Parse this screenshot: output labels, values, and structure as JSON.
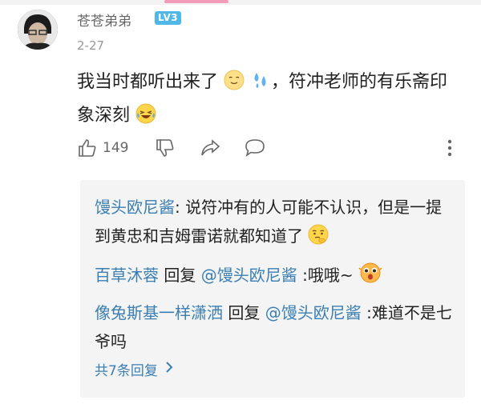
{
  "comment": {
    "username": "苍苍弟弟",
    "level": "LV3",
    "date": "2-27",
    "content_part1": "我当时都听出来了",
    "content_part2": "，符冲老师的有乐斋印象深刻",
    "like_count": "149"
  },
  "replies": [
    {
      "author": "馒头欧尼酱",
      "separator": ": ",
      "text": "说符冲有的人可能不认识，但是一提到黄忠和吉姆雷诺就都知道了"
    },
    {
      "author": "百草沐蓉",
      "reply_word": " 回复 ",
      "target": "@馒头欧尼酱",
      "text": " :哦哦~"
    },
    {
      "author": "像兔斯基一样潇洒",
      "reply_word": " 回复 ",
      "target": "@馒头欧尼酱",
      "text": " :难道不是七爷吗"
    }
  ],
  "more_replies": "共7条回复",
  "icons": {
    "like": "thumb-up-icon",
    "dislike": "thumb-down-icon",
    "share": "share-icon",
    "comment": "comment-icon",
    "more": "more-vertical-icon",
    "arrow": "chevron-right-icon"
  },
  "colors": {
    "link": "#3b7eb3",
    "level_badge": "#4fb8e6"
  }
}
